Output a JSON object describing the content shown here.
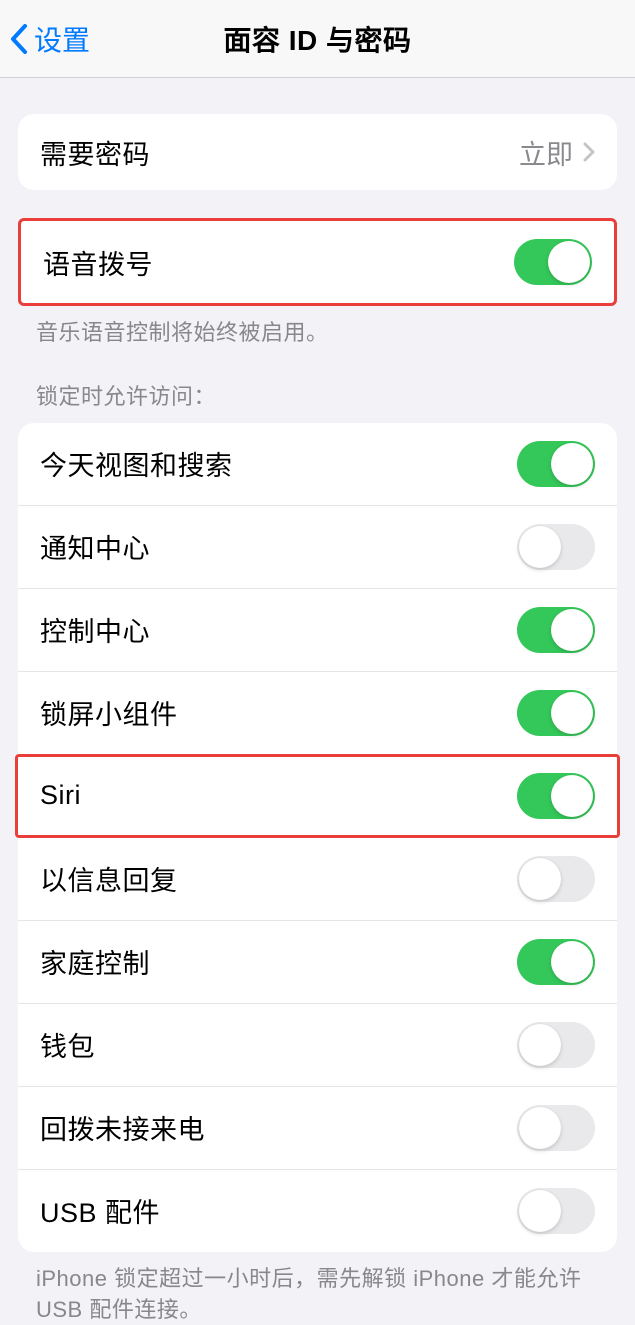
{
  "nav": {
    "back_label": "设置",
    "title": "面容 ID 与密码"
  },
  "require_passcode": {
    "label": "需要密码",
    "value": "立即"
  },
  "voice_dial": {
    "label": "语音拨号",
    "footer": "音乐语音控制将始终被启用。"
  },
  "locked_access": {
    "header": "锁定时允许访问：",
    "items": [
      {
        "label": "今天视图和搜索",
        "on": true
      },
      {
        "label": "通知中心",
        "on": false
      },
      {
        "label": "控制中心",
        "on": true
      },
      {
        "label": "锁屏小组件",
        "on": true
      },
      {
        "label": "Siri",
        "on": true
      },
      {
        "label": "以信息回复",
        "on": false
      },
      {
        "label": "家庭控制",
        "on": true
      },
      {
        "label": "钱包",
        "on": false
      },
      {
        "label": "回拨未接来电",
        "on": false
      },
      {
        "label": "USB 配件",
        "on": false
      }
    ],
    "footer": "iPhone 锁定超过一小时后，需先解锁 iPhone 才能允许 USB 配件连接。"
  }
}
